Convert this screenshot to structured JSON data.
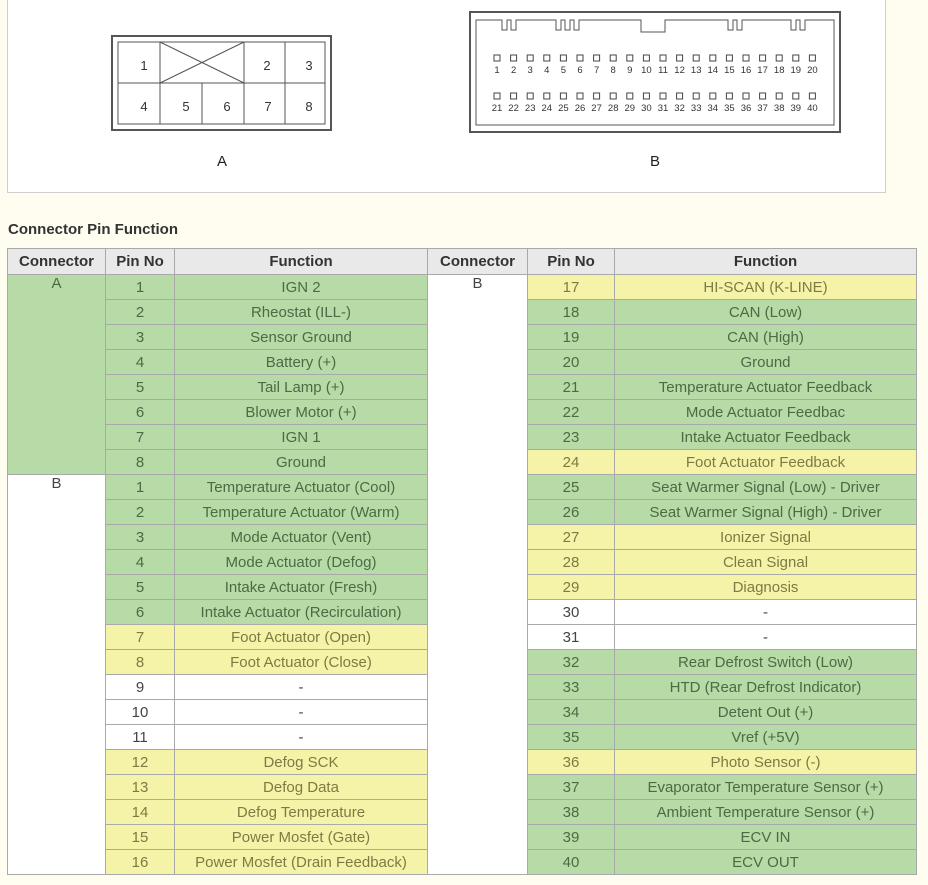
{
  "connector_a": {
    "caption": "A",
    "pins": [
      "1",
      "2",
      "3",
      "4",
      "5",
      "6",
      "7",
      "8"
    ]
  },
  "connector_b": {
    "caption": "B",
    "row1": [
      "1",
      "2",
      "3",
      "4",
      "5",
      "6",
      "7",
      "8",
      "9",
      "10",
      "11",
      "12",
      "13",
      "14",
      "15",
      "16",
      "17",
      "18",
      "19",
      "20"
    ],
    "row2": [
      "21",
      "22",
      "23",
      "24",
      "25",
      "26",
      "27",
      "28",
      "29",
      "30",
      "31",
      "32",
      "33",
      "34",
      "35",
      "36",
      "37",
      "38",
      "39",
      "40"
    ]
  },
  "section_title": "Connector Pin Function",
  "headers": [
    "Connector",
    "Pin No",
    "Function",
    "Connector",
    "Pin No",
    "Function"
  ],
  "left_groups": [
    {
      "connector": "A",
      "rows": [
        {
          "pin": "1",
          "func": "IGN 2",
          "hl": "green"
        },
        {
          "pin": "2",
          "func": "Rheostat (ILL-)",
          "hl": "green"
        },
        {
          "pin": "3",
          "func": "Sensor Ground",
          "hl": "green"
        },
        {
          "pin": "4",
          "func": "Battery (+)",
          "hl": "green"
        },
        {
          "pin": "5",
          "func": "Tail Lamp (+)",
          "hl": "green"
        },
        {
          "pin": "6",
          "func": "Blower Motor (+)",
          "hl": "green"
        },
        {
          "pin": "7",
          "func": "IGN 1",
          "hl": "green"
        },
        {
          "pin": "8",
          "func": "Ground",
          "hl": "green"
        }
      ]
    },
    {
      "connector": "B",
      "rows": [
        {
          "pin": "1",
          "func": "Temperature Actuator (Cool)",
          "hl": "green"
        },
        {
          "pin": "2",
          "func": "Temperature Actuator (Warm)",
          "hl": "green"
        },
        {
          "pin": "3",
          "func": "Mode Actuator (Vent)",
          "hl": "green"
        },
        {
          "pin": "4",
          "func": "Mode Actuator (Defog)",
          "hl": "green"
        },
        {
          "pin": "5",
          "func": "Intake Actuator (Fresh)",
          "hl": "green"
        },
        {
          "pin": "6",
          "func": "Intake Actuator (Recirculation)",
          "hl": "green"
        },
        {
          "pin": "7",
          "func": "Foot Actuator (Open)",
          "hl": "yellow"
        },
        {
          "pin": "8",
          "func": "Foot Actuator (Close)",
          "hl": "yellow"
        },
        {
          "pin": "9",
          "func": "-",
          "hl": ""
        },
        {
          "pin": "10",
          "func": "-",
          "hl": ""
        },
        {
          "pin": "11",
          "func": "-",
          "hl": ""
        },
        {
          "pin": "12",
          "func": "Defog SCK",
          "hl": "yellow"
        },
        {
          "pin": "13",
          "func": "Defog Data",
          "hl": "yellow"
        },
        {
          "pin": "14",
          "func": "Defog Temperature",
          "hl": "yellow"
        },
        {
          "pin": "15",
          "func": "Power Mosfet (Gate)",
          "hl": "yellow"
        },
        {
          "pin": "16",
          "func": "Power Mosfet (Drain Feedback)",
          "hl": "yellow"
        }
      ]
    }
  ],
  "right_group": {
    "connector": "B",
    "rows": [
      {
        "pin": "17",
        "func": "HI-SCAN (K-LINE)",
        "hl": "yellow"
      },
      {
        "pin": "18",
        "func": "CAN (Low)",
        "hl": "green"
      },
      {
        "pin": "19",
        "func": "CAN (High)",
        "hl": "green"
      },
      {
        "pin": "20",
        "func": "Ground",
        "hl": "green"
      },
      {
        "pin": "21",
        "func": "Temperature Actuator Feedback",
        "hl": "green"
      },
      {
        "pin": "22",
        "func": "Mode Actuator Feedbac",
        "hl": "green"
      },
      {
        "pin": "23",
        "func": "Intake Actuator Feedback",
        "hl": "green"
      },
      {
        "pin": "24",
        "func": "Foot Actuator Feedback",
        "hl": "yellow"
      },
      {
        "pin": "25",
        "func": "Seat Warmer Signal (Low) - Driver",
        "hl": "green"
      },
      {
        "pin": "26",
        "func": "Seat Warmer Signal (High) - Driver",
        "hl": "green"
      },
      {
        "pin": "27",
        "func": "Ionizer Signal",
        "hl": "yellow"
      },
      {
        "pin": "28",
        "func": "Clean Signal",
        "hl": "yellow"
      },
      {
        "pin": "29",
        "func": "Diagnosis",
        "hl": "yellow"
      },
      {
        "pin": "30",
        "func": "-",
        "hl": ""
      },
      {
        "pin": "31",
        "func": "-",
        "hl": ""
      },
      {
        "pin": "32",
        "func": "Rear Defrost Switch (Low)",
        "hl": "green"
      },
      {
        "pin": "33",
        "func": "HTD (Rear Defrost Indicator)",
        "hl": "green"
      },
      {
        "pin": "34",
        "func": "Detent Out (+)",
        "hl": "green"
      },
      {
        "pin": "35",
        "func": "Vref (+5V)",
        "hl": "green"
      },
      {
        "pin": "36",
        "func": "Photo Sensor (-)",
        "hl": "yellow"
      },
      {
        "pin": "37",
        "func": "Evaporator Temperature Sensor (+)",
        "hl": "green"
      },
      {
        "pin": "38",
        "func": "Ambient Temperature Sensor (+)",
        "hl": "green"
      },
      {
        "pin": "39",
        "func": "ECV IN",
        "hl": "green"
      },
      {
        "pin": "40",
        "func": "ECV OUT",
        "hl": "green"
      }
    ]
  }
}
